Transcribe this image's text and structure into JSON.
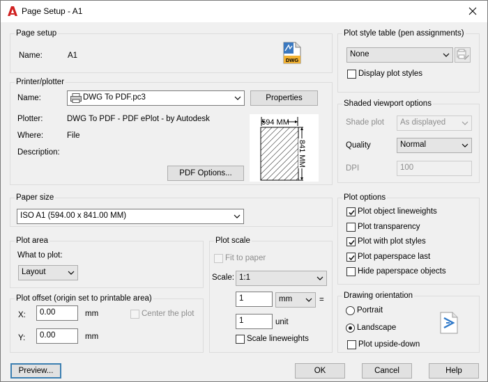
{
  "window": {
    "title": "Page Setup - A1"
  },
  "page_setup": {
    "group_title": "Page setup",
    "name_label": "Name:",
    "name_value": "A1",
    "dwg_icon_text": "DWG"
  },
  "printer": {
    "group_title": "Printer/plotter",
    "name_label": "Name:",
    "name_value": "DWG To PDF.pc3",
    "properties_label": "Properties",
    "plotter_label": "Plotter:",
    "plotter_value": "DWG To PDF - PDF ePlot - by Autodesk",
    "where_label": "Where:",
    "where_value": "File",
    "description_label": "Description:",
    "pdf_options_label": "PDF Options...",
    "preview_width": "594 MM",
    "preview_height": "841 MM"
  },
  "paper_size": {
    "group_title": "Paper size",
    "value": "ISO A1 (594.00 x 841.00 MM)"
  },
  "plot_area": {
    "group_title": "Plot area",
    "what_label": "What to plot:",
    "value": "Layout"
  },
  "plot_offset": {
    "group_title": "Plot offset (origin set to printable area)",
    "x_label": "X:",
    "x_value": "0.00",
    "x_unit": "mm",
    "y_label": "Y:",
    "y_value": "0.00",
    "y_unit": "mm",
    "center_label": "Center the plot"
  },
  "plot_scale": {
    "group_title": "Plot scale",
    "fit_label": "Fit to paper",
    "scale_label": "Scale:",
    "scale_value": "1:1",
    "value1": "1",
    "unit_select": "mm",
    "equals": "=",
    "value2": "1",
    "unit_label": "unit",
    "lineweights_label": "Scale lineweights"
  },
  "plot_style": {
    "group_title": "Plot style table (pen assignments)",
    "value": "None",
    "display_label": "Display plot styles"
  },
  "shaded": {
    "group_title": "Shaded viewport options",
    "shade_label": "Shade plot",
    "shade_value": "As displayed",
    "quality_label": "Quality",
    "quality_value": "Normal",
    "dpi_label": "DPI",
    "dpi_value": "100"
  },
  "plot_options": {
    "group_title": "Plot options",
    "items": [
      {
        "label": "Plot object lineweights",
        "checked": true
      },
      {
        "label": "Plot transparency",
        "checked": false
      },
      {
        "label": "Plot with plot styles",
        "checked": true
      },
      {
        "label": "Plot paperspace last",
        "checked": true
      },
      {
        "label": "Hide paperspace objects",
        "checked": false
      }
    ]
  },
  "orientation": {
    "group_title": "Drawing orientation",
    "portrait_label": "Portrait",
    "landscape_label": "Landscape",
    "upside_down_label": "Plot upside-down",
    "selected": "Landscape"
  },
  "footer": {
    "preview_label": "Preview...",
    "ok_label": "OK",
    "cancel_label": "Cancel",
    "help_label": "Help"
  },
  "colors": {
    "accent": "#3c7fb1",
    "autocad_red": "#d02020",
    "dialog_bg": "#f0f0f0"
  }
}
